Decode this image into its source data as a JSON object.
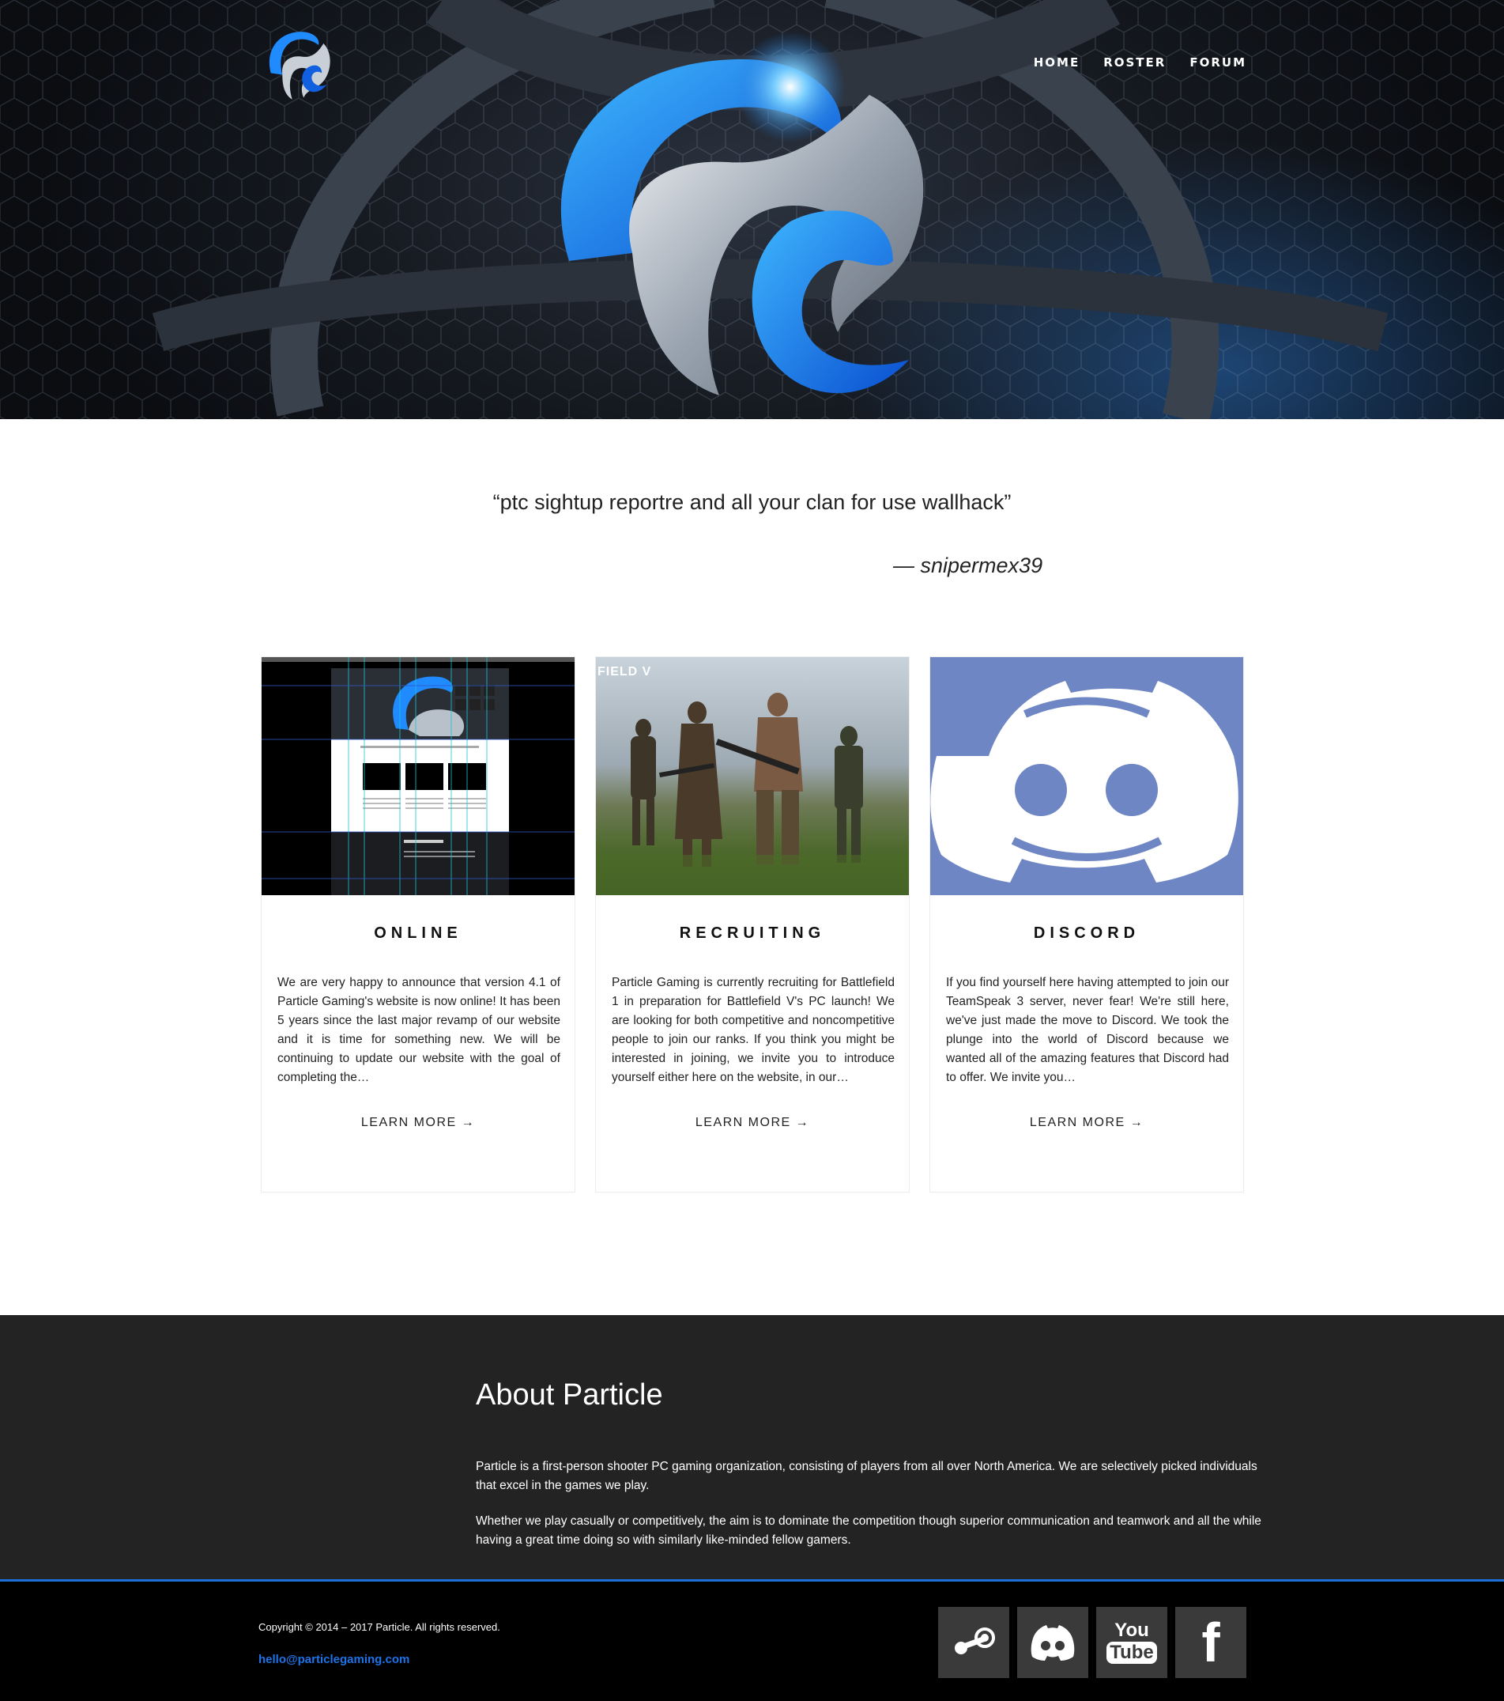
{
  "nav": {
    "items": [
      {
        "label": "HOME"
      },
      {
        "label": "ROSTER"
      },
      {
        "label": "FORUM"
      }
    ]
  },
  "quote": {
    "text": "“ptc sightup reportre and all your clan for use wallhack”",
    "author": "— snipermex39"
  },
  "cards": [
    {
      "title": "ONLINE",
      "text": "We are very happy to announce that version 4.1 of Particle Gaming's website is now online! It has been 5 years since the last major revamp of our website and it is time for something new. We will be continuing to update our website with the goal of completing the…",
      "link": "LEARN MORE →"
    },
    {
      "title": "RECRUITING",
      "text": "Particle Gaming is currently recruiting for Battlefield 1 in preparation for Battlefield V's PC launch! We are looking for both competitive and noncompetitive people to join our ranks. If you think you might be interested in joining, we invite you to introduce yourself either here on the website, in our…",
      "link": "LEARN MORE →",
      "image_text": "FIELD V"
    },
    {
      "title": "DISCORD",
      "text": "If you find yourself here having attempted to join our TeamSpeak 3 server, never fear! We're still here, we've just made the move to Discord. We took the plunge into the world of Discord because we wanted all of the amazing features that Discord had to offer. We invite you…",
      "link": "LEARN MORE →"
    }
  ],
  "about": {
    "title": "About Particle",
    "paragraphs": [
      "Particle is a first-person shooter PC gaming organization, consisting of players from all over North America. We are selectively picked individuals that excel in the games we play.",
      "Whether we play casually or competitively, the aim is to dominate the competition though superior communication and teamwork and all the while having a great time doing so with similarly like-minded fellow gamers."
    ]
  },
  "footer": {
    "copyright": "Copyright © 2014 – 2017 Particle. All rights reserved.",
    "email": "hello@particlegaming.com",
    "social": [
      {
        "icon": "steam-icon"
      },
      {
        "icon": "discord-icon"
      },
      {
        "icon": "youtube-icon",
        "text_top": "You",
        "text_bottom": "Tube"
      },
      {
        "icon": "facebook-icon",
        "text": "f"
      }
    ]
  },
  "colors": {
    "accent": "#1e73e8",
    "about_bg": "#232323",
    "footer_bg": "#000000",
    "discord_blue": "#6f86c4"
  }
}
